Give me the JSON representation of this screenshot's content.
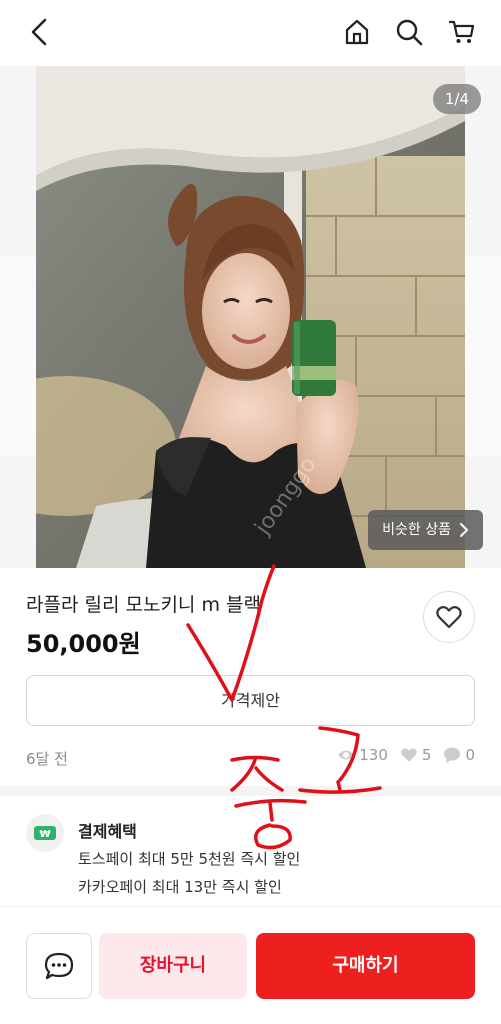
{
  "header": {
    "back_icon": "chevron-left-icon",
    "home_icon": "home-icon",
    "search_icon": "search-icon",
    "cart_icon": "cart-icon"
  },
  "gallery": {
    "counter": "1/4",
    "similar_label": "비슷한 상품",
    "watermark": "joonggo"
  },
  "product": {
    "title": "라플라 릴리 모노키니 m 블랙",
    "price": "50,000원"
  },
  "actions": {
    "offer_label": "가격제안"
  },
  "meta": {
    "time_ago": "6달 전",
    "views": "130",
    "likes": "5",
    "chats": "0"
  },
  "benefits": {
    "title": "결제혜택",
    "line1": "토스페이 최대 5만 5천원 즉시 할인",
    "line2": "카카오페이 최대 13만 즉시 할인",
    "icon_glyph": "₩"
  },
  "bottom": {
    "cart_label": "장바구니",
    "buy_label": "구매하기"
  },
  "annotation": {
    "handwritten_text": "중고",
    "color": "#e0101a"
  },
  "colors": {
    "accent": "#ee1f1f",
    "cart_bg": "#fde9ec"
  }
}
